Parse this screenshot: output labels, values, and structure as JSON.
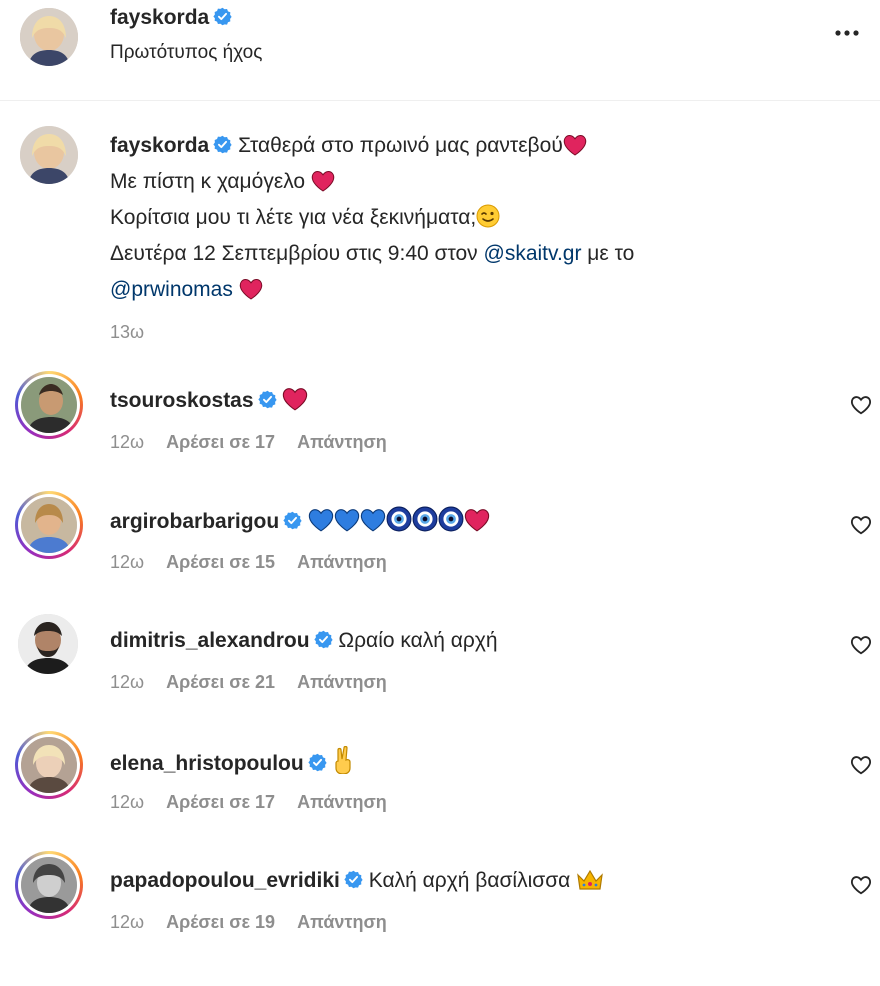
{
  "header": {
    "username": "fayskorda",
    "audio": "Πρωτότυπος ήχος"
  },
  "post": {
    "username": "fayskorda",
    "line1": "Σταθερά στο πρωινό μας ραντεβού",
    "line2": "Με πίστη κ χαμόγελο",
    "line3": "Κορίτσια μου τι λέτε για νέα ξεκινήματα;",
    "line4_pre": "Δευτέρα 12 Σεπτεμβρίου στις 9:40 στον",
    "mention1": "@skaitv.gr",
    "line4_post": "με το",
    "mention2": "@prwinomas",
    "time": "13ω"
  },
  "comments": [
    {
      "username": "tsouroskostas",
      "text": "",
      "time": "12ω",
      "likes": "Αρέσει σε 17",
      "reply": "Απάντηση"
    },
    {
      "username": "argirobarbarigou",
      "text": "",
      "time": "12ω",
      "likes": "Αρέσει σε 15",
      "reply": "Απάντηση"
    },
    {
      "username": "dimitris_alexandrou",
      "text": "Ωραίο καλή αρχή",
      "time": "12ω",
      "likes": "Αρέσει σε 21",
      "reply": "Απάντηση"
    },
    {
      "username": "elena_hristopoulou",
      "text": "",
      "time": "12ω",
      "likes": "Αρέσει σε 17",
      "reply": "Απάντηση"
    },
    {
      "username": "papadopoulou_evridiki",
      "text": "Καλή αρχή βασίλισσα",
      "time": "12ω",
      "likes": "Αρέσει σε 19",
      "reply": "Απάντηση"
    }
  ],
  "icons": {
    "verified": "verified-badge-icon",
    "more": "more-options-icon",
    "like": "heart-outline-icon"
  },
  "colors": {
    "verified": "#3897f0",
    "mention": "#00376b",
    "muted": "#8e8e8e",
    "heart": "#e0245e"
  }
}
